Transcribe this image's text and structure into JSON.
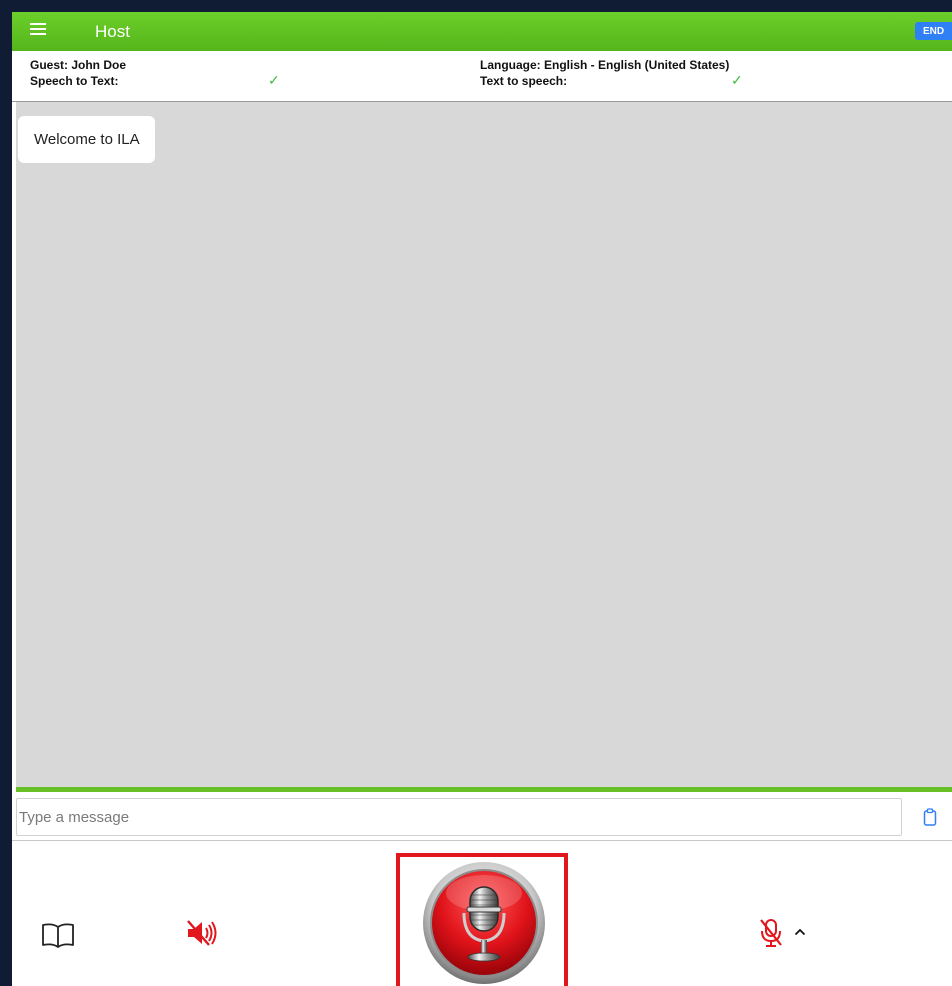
{
  "header": {
    "title": "Host",
    "end_label": "END",
    "bar_color": "#5cbf20",
    "end_color": "#2f7ff5"
  },
  "info": {
    "guest_label": "Guest: John Doe",
    "language_label": "Language: English - English (United States)",
    "stt_label": "Speech to Text:",
    "tts_label": "Text to speech:",
    "stt_status": "✓",
    "tts_status": "✓"
  },
  "chat": {
    "messages": [
      "Welcome to ILA"
    ],
    "background": "#d8d8d8"
  },
  "composer": {
    "placeholder": "Type a message",
    "value": ""
  },
  "controls": {
    "icons": [
      "book-icon",
      "speaker-muted-icon",
      "microphone-record-button",
      "microphone-off-icon",
      "chevron-up-icon"
    ],
    "record_color": "#e1171d"
  }
}
